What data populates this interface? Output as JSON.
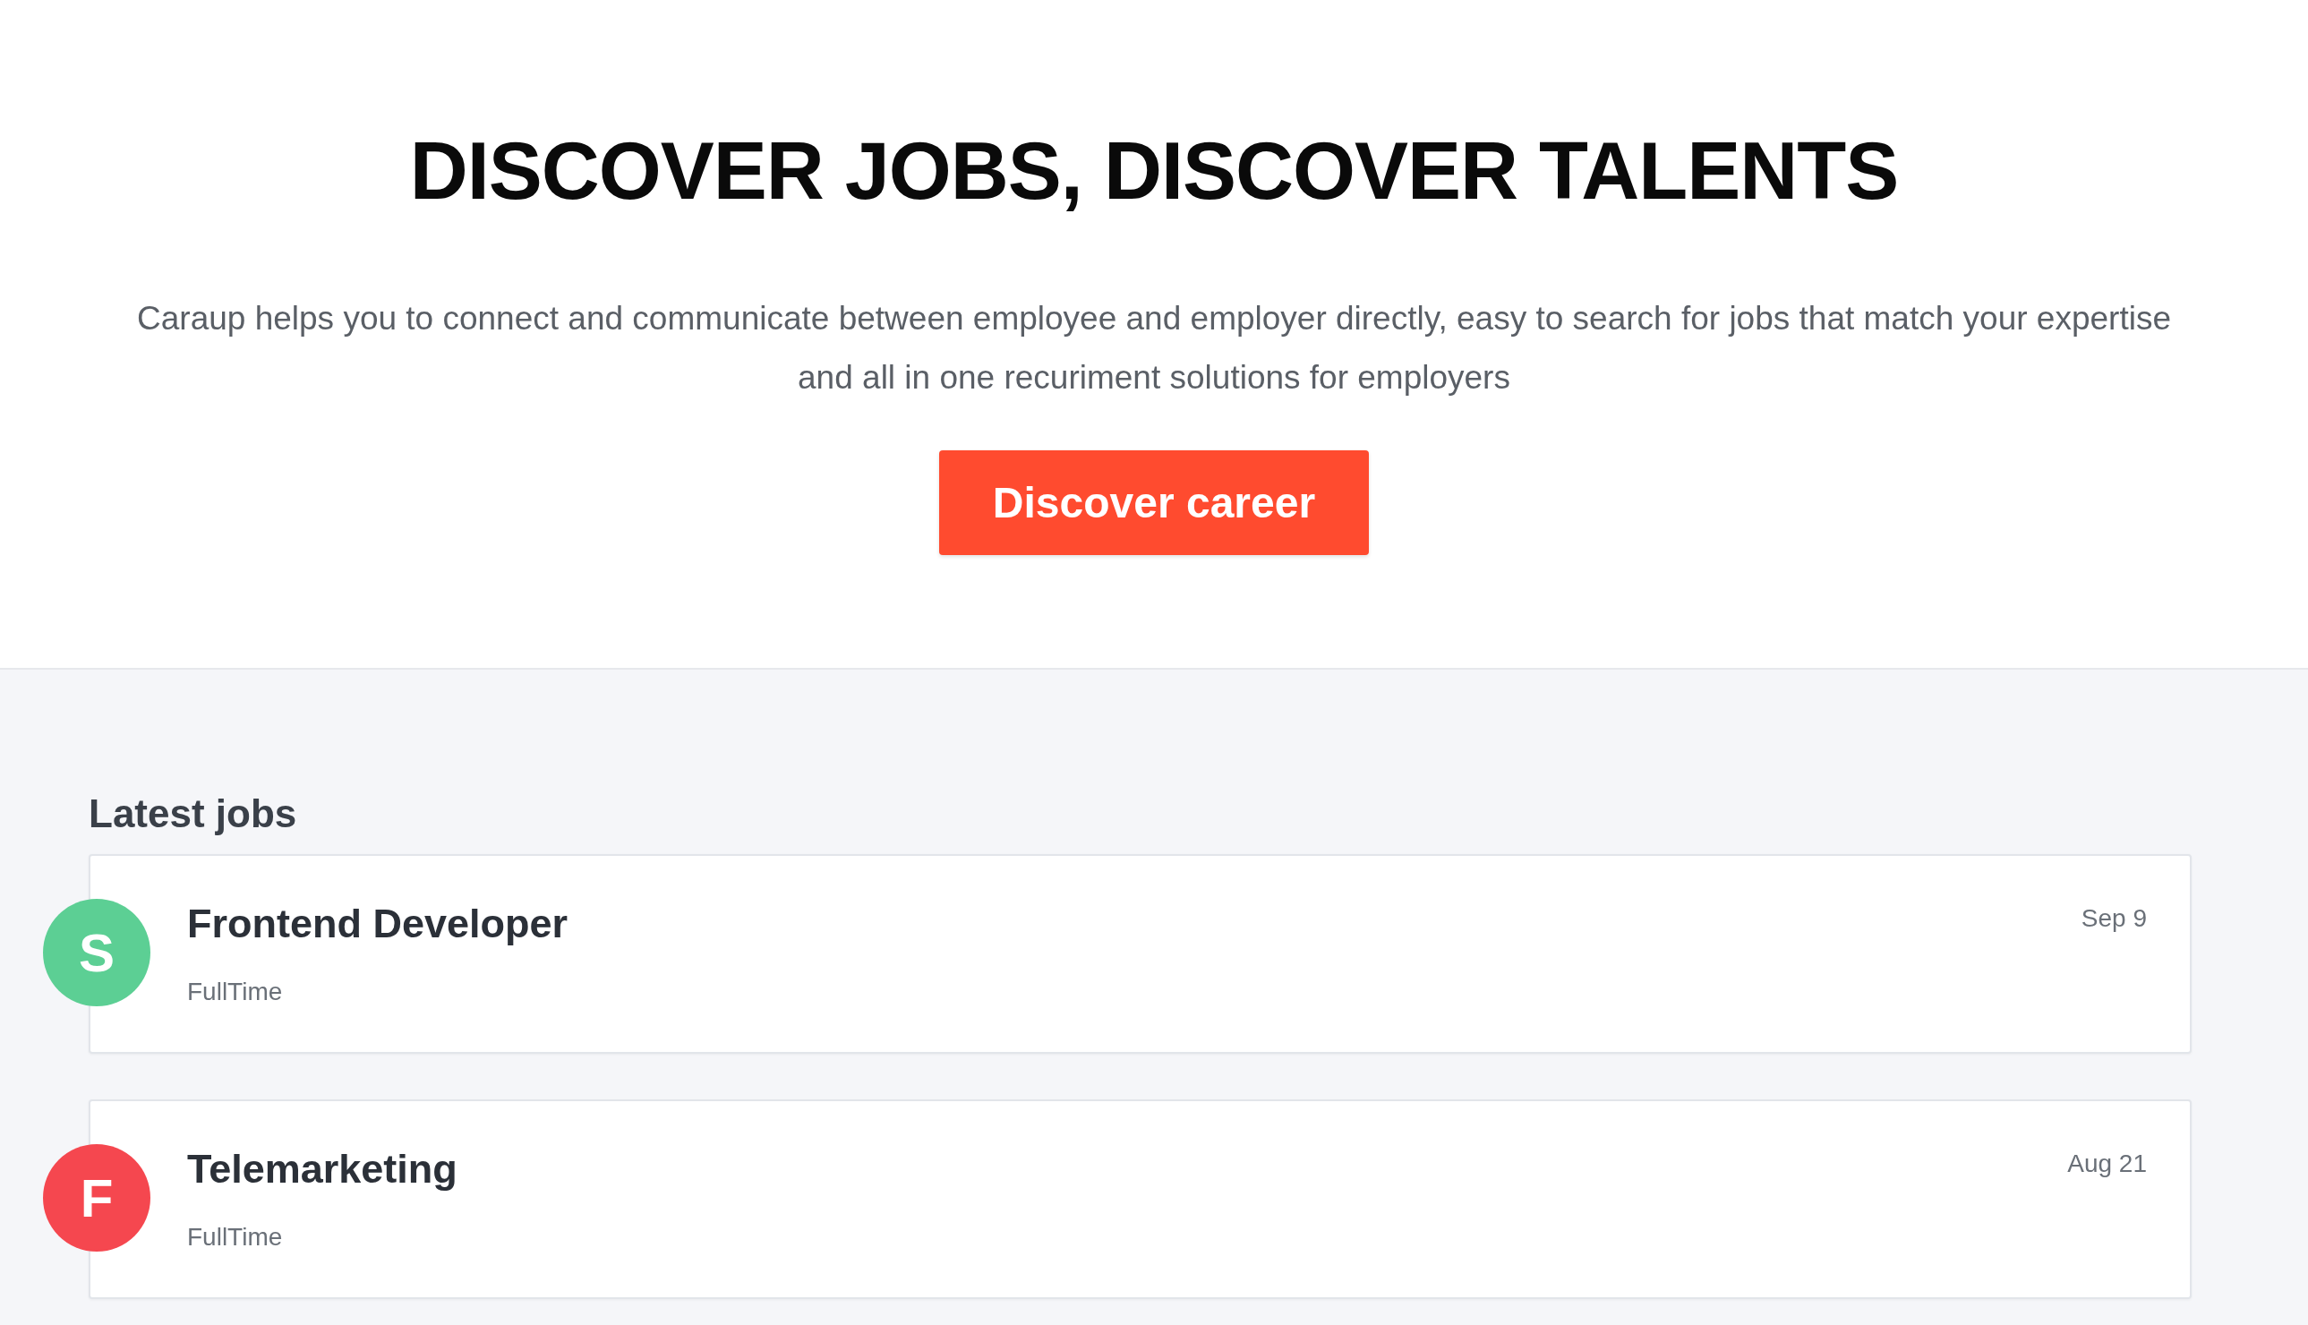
{
  "hero": {
    "title": "DISCOVER JOBS, DISCOVER TALENTS",
    "description": "Caraup helps you to connect and communicate between employee and employer directly, easy to search for jobs that match your expertise and all in one recuriment solutions for employers",
    "button": "Discover career"
  },
  "latest_jobs": {
    "heading": "Latest jobs",
    "jobs": [
      {
        "initial": "S",
        "color": "#5ccf94",
        "title": "Frontend Developer",
        "type": "FullTime",
        "date": "Sep 9"
      },
      {
        "initial": "F",
        "color": "#f5474f",
        "title": "Telemarketing",
        "type": "FullTime",
        "date": "Aug 21"
      }
    ]
  }
}
